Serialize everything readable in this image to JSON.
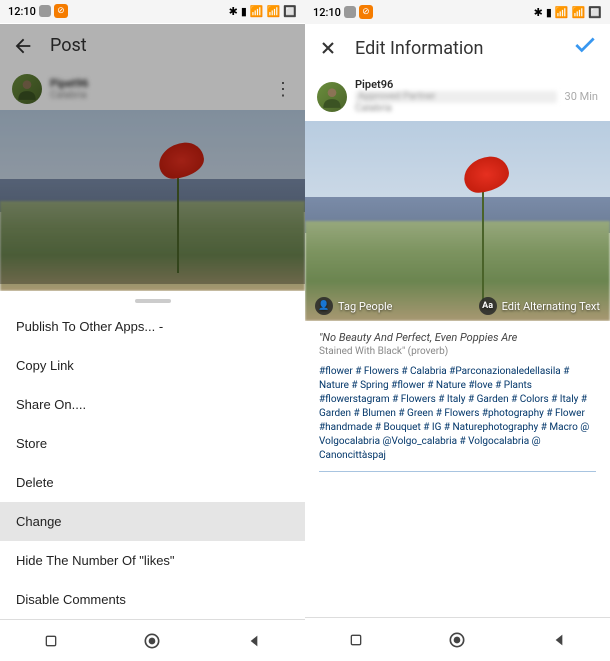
{
  "status": {
    "time": "12:10",
    "icons_right": [
      "bluetooth",
      "silent",
      "signal",
      "signal",
      "battery"
    ]
  },
  "left": {
    "header_title": "Post",
    "username": "Pipet96",
    "location": "Calabria",
    "sheet": {
      "publish": "Publish To Other Apps... -",
      "copylink": "Copy Link",
      "shareon": "Share On....",
      "store": "Store",
      "delete": "Delete",
      "change": "Change",
      "hidelikes": "Hide The Number Of \"likes\"",
      "disablecomments": "Disable Comments"
    }
  },
  "right": {
    "header_title": "Edit Information",
    "username": "Pipet96",
    "partner": "Approved Partner",
    "location": "Calabria",
    "timestamp": "30 Min",
    "tag_people": "Tag People",
    "edit_alt": "Edit Alternating Text",
    "caption_quote": "\"No Beauty And Perfect, Even Poppies Are",
    "caption_sub": "Stained With Black\" (proverb)",
    "hashtags": "#flower # Flowers # Calabria #Parconazionaledellasila # Nature # Spring #flower # Nature #love # Plants #flowerstagram # Flowers # Italy # Garden # Colors # Italy # Garden # Blumen # Green # Flowers #photography # Flower #handmade # Bouquet # IG # Naturephotography # Macro @ Volgocalabria @Volgo_calabria # Volgocalabria @ Canoncittàspaj"
  }
}
